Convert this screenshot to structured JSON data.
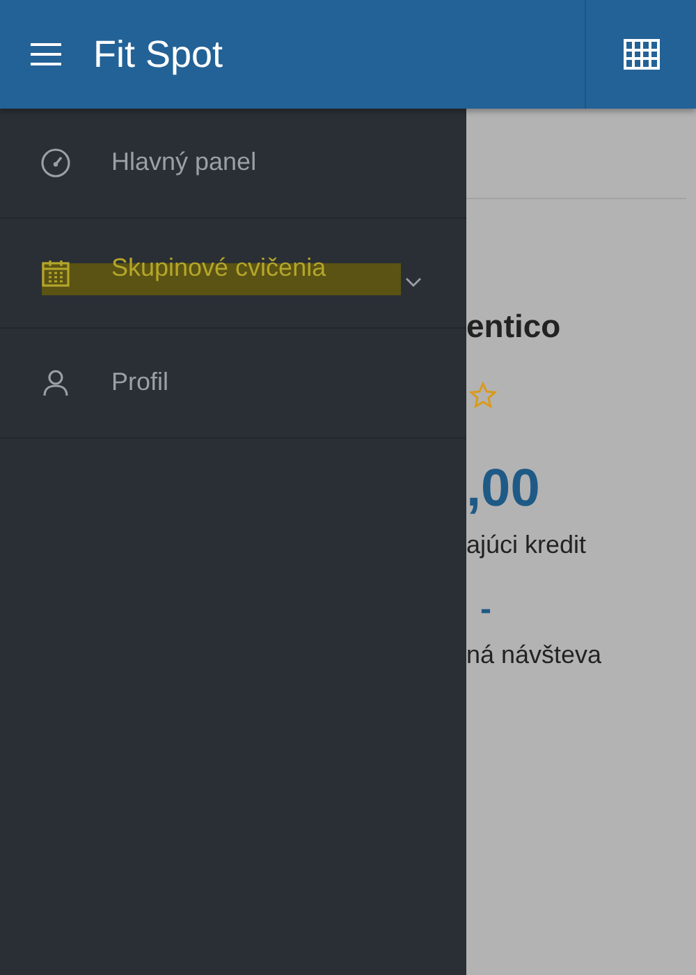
{
  "app_bar": {
    "title": "Fit Spot"
  },
  "drawer": {
    "items": [
      {
        "label": "Hlavný panel",
        "kind": "gauge",
        "selected": false,
        "expandable": false
      },
      {
        "label": "Skupinové cvičenia",
        "kind": "calendar",
        "selected": true,
        "expandable": true
      },
      {
        "label": "Profil",
        "kind": "person",
        "selected": false,
        "expandable": false
      }
    ]
  },
  "background_page": {
    "name": "entico",
    "credit": ",00",
    "credit_label": "ajúci kredit",
    "visit": "-",
    "visit_label": "ná návšteva"
  }
}
